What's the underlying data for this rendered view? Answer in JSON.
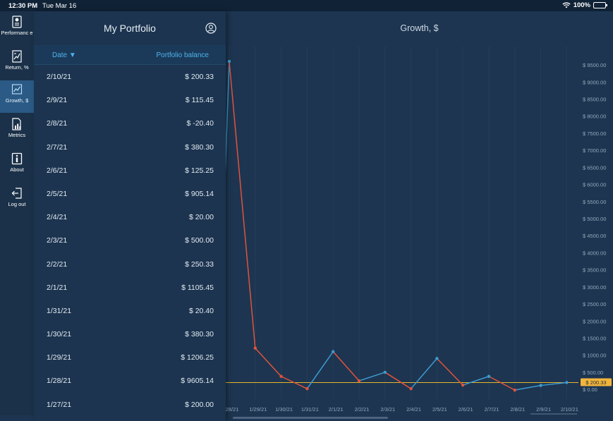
{
  "status_bar": {
    "time": "12:30 PM",
    "date": "Tue Mar 16",
    "battery": "100%"
  },
  "sidebar": {
    "items": [
      {
        "label": "Performanc e",
        "icon": "performance-icon",
        "active": false
      },
      {
        "label": "Return, %",
        "icon": "return-icon",
        "active": false
      },
      {
        "label": "Growth, $",
        "icon": "growth-chart-icon",
        "active": true
      },
      {
        "label": "Metrics",
        "icon": "metrics-icon",
        "active": false
      },
      {
        "label": "About",
        "icon": "info-icon",
        "active": false
      },
      {
        "label": "Log out",
        "icon": "logout-icon",
        "active": false
      }
    ]
  },
  "portfolio": {
    "title": "My Portfolio",
    "user_icon": "user-icon",
    "header": {
      "date": "Date ▼",
      "balance": "Portfolio balance"
    },
    "rows": [
      {
        "date": "2/10/21",
        "balance": "$ 200.33"
      },
      {
        "date": "2/9/21",
        "balance": "$ 115.45"
      },
      {
        "date": "2/8/21",
        "balance": "$ -20.40"
      },
      {
        "date": "2/7/21",
        "balance": "$ 380.30"
      },
      {
        "date": "2/6/21",
        "balance": "$ 125.25"
      },
      {
        "date": "2/5/21",
        "balance": "$ 905.14"
      },
      {
        "date": "2/4/21",
        "balance": "$ 20.00"
      },
      {
        "date": "2/3/21",
        "balance": "$ 500.00"
      },
      {
        "date": "2/2/21",
        "balance": "$ 250.33"
      },
      {
        "date": "2/1/21",
        "balance": "$ 1105.45"
      },
      {
        "date": "1/31/21",
        "balance": "$ 20.40"
      },
      {
        "date": "1/30/21",
        "balance": "$ 380.30"
      },
      {
        "date": "1/29/21",
        "balance": "$ 1206.25"
      },
      {
        "date": "1/28/21",
        "balance": "$ 9605.14"
      },
      {
        "date": "1/27/21",
        "balance": "$ 200.00"
      }
    ]
  },
  "growth": {
    "title": "Growth, $"
  },
  "chart_data": {
    "type": "line",
    "title": "Growth, $",
    "x": [
      "1/28/21",
      "1/29/21",
      "1/30/21",
      "1/31/21",
      "2/1/21",
      "2/2/21",
      "2/3/21",
      "2/4/21",
      "2/5/21",
      "2/6/21",
      "2/7/21",
      "2/8/21",
      "2/9/21",
      "2/10/21"
    ],
    "x_tick_labels": [
      "28/21",
      "1/29/21",
      "1/30/21",
      "1/31/21",
      "2/1/21",
      "2/2/21",
      "2/3/21",
      "2/4/21",
      "2/5/21",
      "2/6/21",
      "2/7/21",
      "2/8/21",
      "2/9/21",
      "2/10/21"
    ],
    "values": [
      9605.14,
      1206.25,
      380.3,
      20.4,
      1105.45,
      250.33,
      500.0,
      20.0,
      905.14,
      125.25,
      380.3,
      -20.4,
      115.45,
      200.33
    ],
    "previous_value": 1105.45,
    "ylim": [
      -100,
      9750
    ],
    "y_ticks": [
      0,
      500,
      1000,
      1500,
      2000,
      2500,
      3000,
      3500,
      4000,
      4500,
      5000,
      5500,
      6000,
      6500,
      7000,
      7500,
      8000,
      8500,
      9000,
      9500
    ],
    "y_tick_labels": [
      "$ 0.00",
      "$ 500.00",
      "$ 1000.00",
      "$ 1500.00",
      "$ 2000.00",
      "$ 2500.00",
      "$ 3000.00",
      "$ 3500.00",
      "$ 4000.00",
      "$ 4500.00",
      "$ 5000.00",
      "$ 5500.00",
      "$ 6000.00",
      "$ 6500.00",
      "$ 7000.00",
      "$ 7500.00",
      "$ 8000.00",
      "$ 8500.00",
      "$ 9000.00",
      "$ 9500.00"
    ],
    "reference_line": {
      "value": 200.33,
      "label": "$ 200.33"
    },
    "colors": {
      "up": "#3d9bd1",
      "down": "#e0533b",
      "reference": "#e8b62b",
      "reference_label_bg": "#f2b53c"
    },
    "grid": true
  }
}
